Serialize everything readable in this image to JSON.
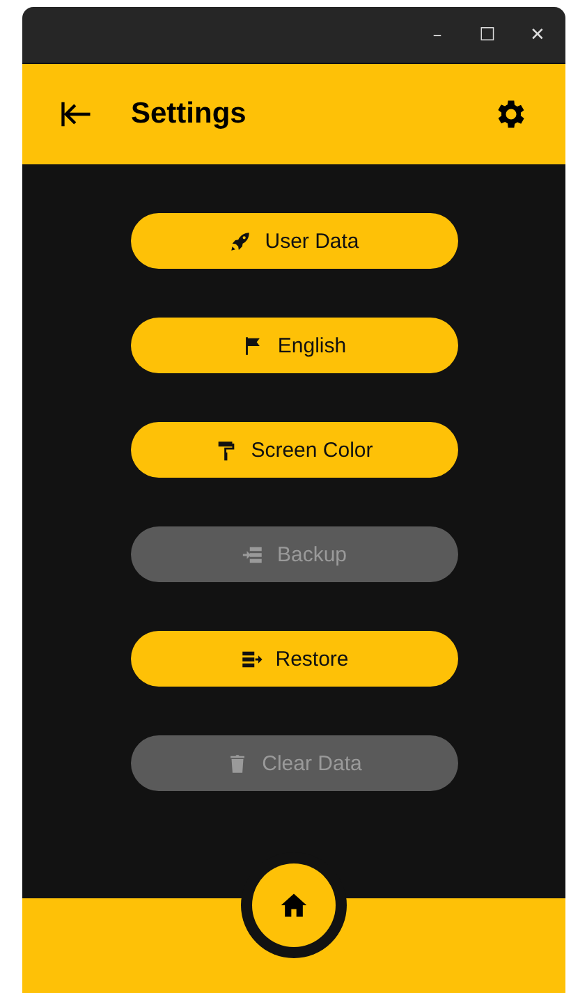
{
  "window": {
    "controls": [
      "–",
      "☐",
      "✕"
    ]
  },
  "header": {
    "title": "Settings"
  },
  "menu": [
    {
      "label": "User Data",
      "disabled": false
    },
    {
      "label": "English",
      "disabled": false
    },
    {
      "label": "Screen Color",
      "disabled": false
    },
    {
      "label": "Backup",
      "disabled": true
    },
    {
      "label": "Restore",
      "disabled": false
    },
    {
      "label": "Clear Data",
      "disabled": true
    }
  ]
}
